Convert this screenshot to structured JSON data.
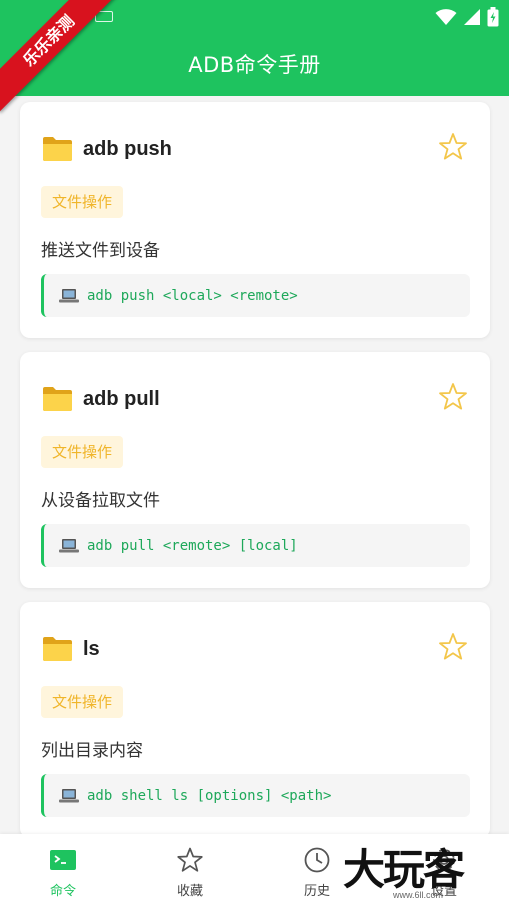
{
  "app": {
    "title": "ADB命令手册"
  },
  "watermark": {
    "ribbon": "乐乐亲测",
    "brand": "大玩客",
    "url": "www.6ll.com"
  },
  "colors": {
    "accent": "#1ec35f",
    "tag_bg": "#fff5dc",
    "tag_text": "#f0b52a",
    "cmd_text": "#1ea85a",
    "star": "#f3c64a"
  },
  "commands": [
    {
      "icon": "folder-icon",
      "title": "adb push",
      "tag": "文件操作",
      "description": "推送文件到设备",
      "command": "adb push <local> <remote>"
    },
    {
      "icon": "folder-icon",
      "title": "adb pull",
      "tag": "文件操作",
      "description": "从设备拉取文件",
      "command": "adb pull <remote> [local]"
    },
    {
      "icon": "folder-icon",
      "title": "ls",
      "tag": "文件操作",
      "description": "列出目录内容",
      "command": "adb shell ls [options] <path>"
    }
  ],
  "nav": {
    "items": [
      {
        "label": "命令",
        "icon": "terminal-icon",
        "active": true
      },
      {
        "label": "收藏",
        "icon": "star-icon"
      },
      {
        "label": "历史",
        "icon": "clock-icon"
      },
      {
        "label": "设置",
        "icon": "gear-icon"
      }
    ]
  }
}
